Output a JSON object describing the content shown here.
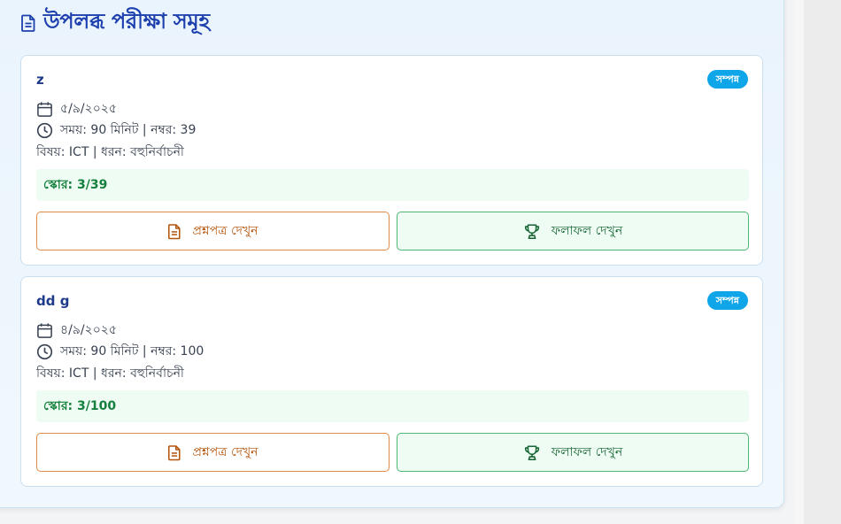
{
  "header": {
    "title": "উপলব্ধ পরীক্ষা সমূহ",
    "icon": "document-icon"
  },
  "exams": [
    {
      "title": "z",
      "status": "সম্পন্ন",
      "date": "৫/৯/২০২৫",
      "duration_marks": "সময়: 90 মিনিট | নম্বর: 39",
      "subject_type": "বিষয়: ICT | ধরন: বহুনির্বাচনী",
      "score": "স্কোর: 3/39",
      "question_button": "প্রশ্নপত্র দেখুন",
      "result_button": "ফলাফল দেখুন"
    },
    {
      "title": "dd g",
      "status": "সম্পন্ন",
      "date": "৪/৯/২০২৫",
      "duration_marks": "সময়: 90 মিনিট | নম্বর: 100",
      "subject_type": "বিষয়: ICT | ধরন: বহুনির্বাচনী",
      "score": "স্কোর: 3/100",
      "question_button": "প্রশ্নপত্র দেখুন",
      "result_button": "ফলাফল দেখুন"
    }
  ],
  "colors": {
    "heading": "#1e40af",
    "badge": "#0ea5e9",
    "score_text": "#15803d",
    "question_border": "#e08a47",
    "result_border": "#4cb873"
  }
}
